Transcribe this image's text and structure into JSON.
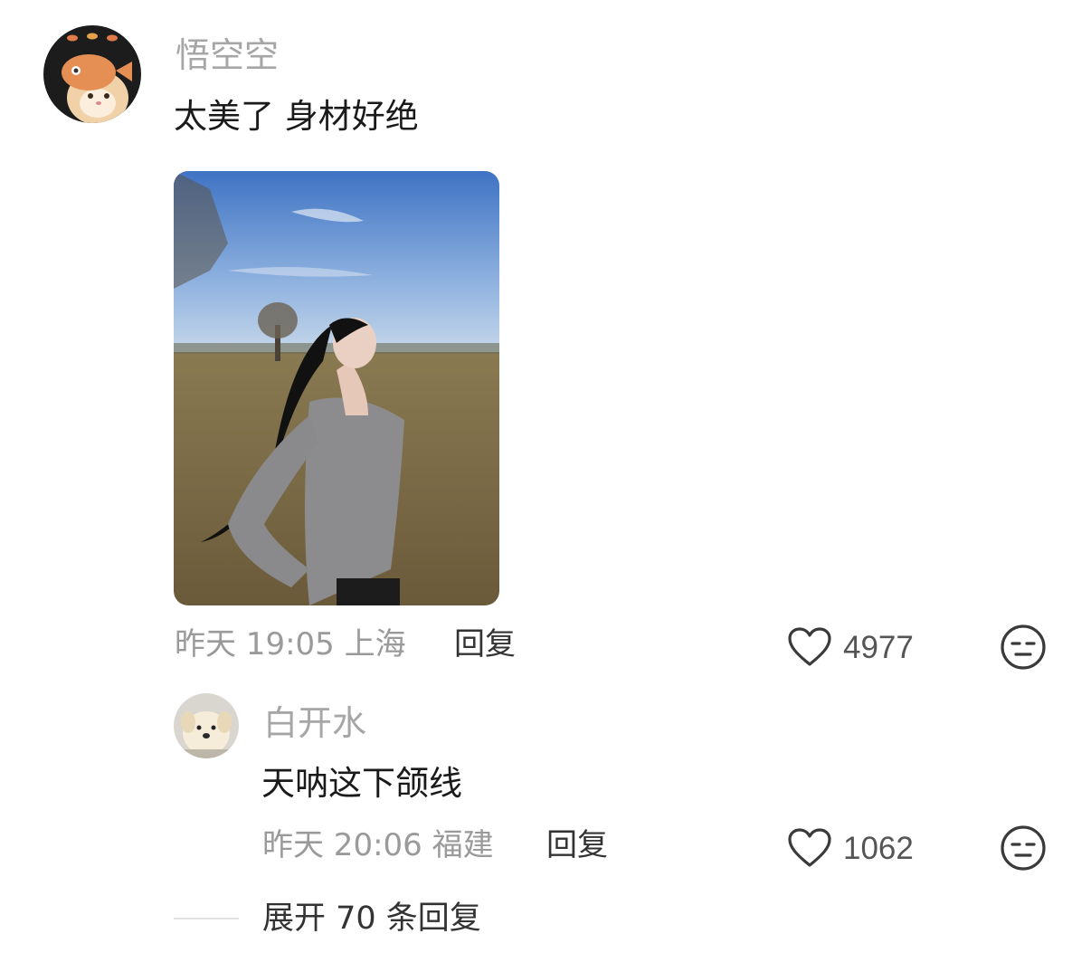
{
  "comment": {
    "username": "悟空空",
    "text": "太美了 身材好绝",
    "time": "昨天 19:05",
    "location": "上海",
    "reply_label": "回复",
    "likes": "4977",
    "avatar_icon": "cat-with-fish-hat-avatar",
    "image_icon": "photo-woman-in-field"
  },
  "reply": {
    "username": "白开水",
    "text": "天呐这下颌线",
    "time": "昨天 20:06",
    "location": "福建",
    "reply_label": "回复",
    "likes": "1062",
    "avatar_icon": "puppy-avatar"
  },
  "expand": {
    "label": "展开 70 条回复"
  },
  "colors": {
    "username": "#a6a6a6",
    "meta": "#9a9a9a",
    "text": "#1a1a1a"
  }
}
